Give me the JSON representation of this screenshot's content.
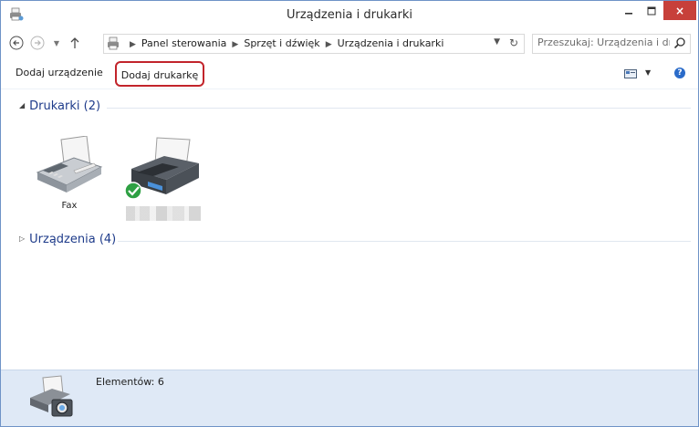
{
  "window": {
    "title": "Urządzenia i drukarki",
    "close_glyph": "×"
  },
  "address": {
    "crumbs": [
      "Panel sterowania",
      "Sprzęt i dźwięk",
      "Urządzenia i drukarki"
    ],
    "search_placeholder": "Przeszukaj: Urządzenia i druka..."
  },
  "toolbar": {
    "add_device": "Dodaj urządzenie",
    "add_printer": "Dodaj drukarkę",
    "help_glyph": "?"
  },
  "groups": {
    "printers": "Drukarki (2)",
    "devices": "Urządzenia (4)"
  },
  "printers": [
    {
      "label": "Fax",
      "icon": "fax-icon"
    },
    {
      "label": "",
      "icon": "printer-icon",
      "default": true
    }
  ],
  "details": {
    "count": "Elementów: 6",
    "icon": "printer-camera-icon"
  },
  "colors": {
    "accent_close": "#c7403a",
    "highlight": "#c2242b",
    "group_header": "#1e3b8a",
    "details_bg": "#dfe9f6"
  }
}
